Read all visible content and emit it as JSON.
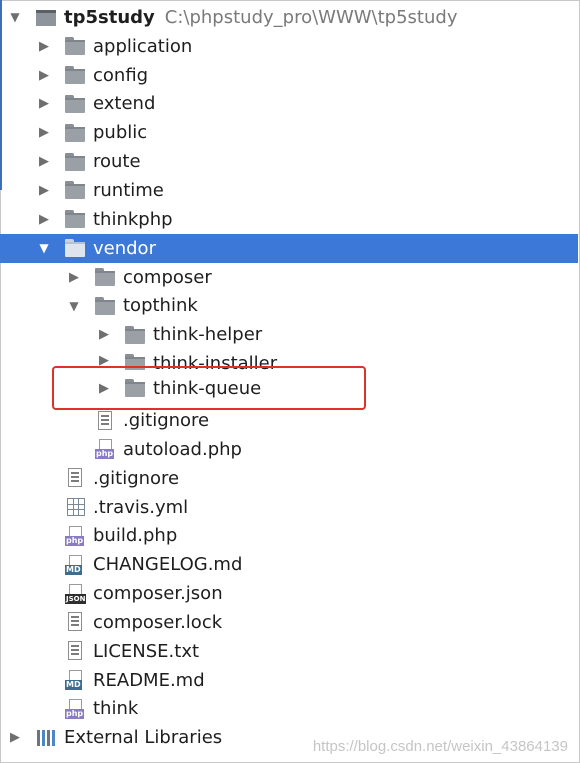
{
  "project": {
    "name": "tp5study",
    "path": "C:\\phpstudy_pro\\WWW\\tp5study"
  },
  "tree": {
    "application": "application",
    "config": "config",
    "extend": "extend",
    "public": "public",
    "route": "route",
    "runtime": "runtime",
    "thinkphp": "thinkphp",
    "vendor": "vendor",
    "composer": "composer",
    "topthink": "topthink",
    "think_helper": "think-helper",
    "think_installer": "think-installer",
    "think_queue": "think-queue",
    "vendor_gitignore": ".gitignore",
    "autoload": "autoload.php",
    "root_gitignore": ".gitignore",
    "travis": ".travis.yml",
    "build": "build.php",
    "changelog": "CHANGELOG.md",
    "composer_json": "composer.json",
    "composer_lock": "composer.lock",
    "license": "LICENSE.txt",
    "readme": "README.md",
    "think": "think",
    "external_libraries": "External Libraries"
  },
  "badges": {
    "php": "php",
    "md": "MD",
    "json": "JSON"
  },
  "selected_item": "vendor",
  "watermark": "https://blog.csdn.net/weixin_43864139",
  "colors": {
    "selection": "#3c78d8",
    "highlight_border": "#e0302a"
  }
}
